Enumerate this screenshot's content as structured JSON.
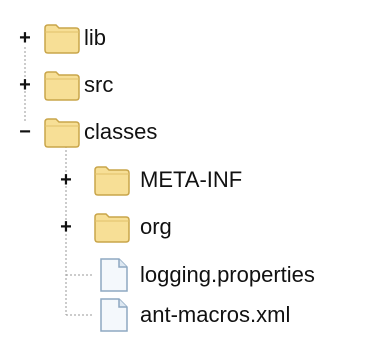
{
  "tree": {
    "nodes": [
      {
        "label": "lib",
        "type": "folder",
        "expanded": false,
        "toggle": "+",
        "icon": "folder-icon"
      },
      {
        "label": "src",
        "type": "folder",
        "expanded": false,
        "toggle": "+",
        "icon": "folder-icon"
      },
      {
        "label": "classes",
        "type": "folder",
        "expanded": true,
        "toggle": "−",
        "icon": "folder-icon",
        "children": [
          {
            "label": "META-INF",
            "type": "folder",
            "expanded": false,
            "toggle": "+",
            "icon": "folder-icon"
          },
          {
            "label": "org",
            "type": "folder",
            "expanded": false,
            "toggle": "+",
            "icon": "folder-icon"
          },
          {
            "label": "logging.properties",
            "type": "file",
            "icon": "file-icon"
          },
          {
            "label": "ant-macros.xml",
            "type": "file",
            "icon": "file-icon"
          }
        ]
      }
    ]
  },
  "colors": {
    "folder_fill": "#f7df96",
    "folder_stroke": "#c9a54a",
    "file_fill": "#f4f8fc",
    "file_stroke": "#8ea8c2",
    "guide_line": "#9a9a9a"
  }
}
